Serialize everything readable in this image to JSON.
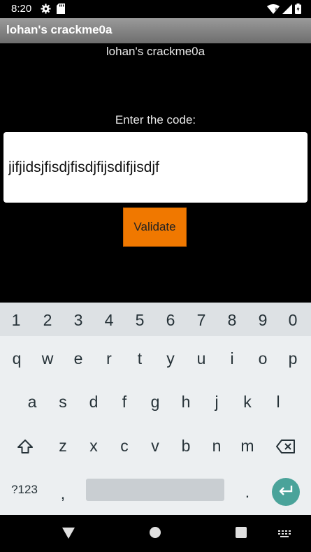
{
  "status_bar": {
    "time": "8:20",
    "icons_left": [
      "gear-icon",
      "sd-card-icon"
    ],
    "icons_right": [
      "wifi-icon",
      "signal-icon",
      "battery-icon"
    ]
  },
  "app_bar": {
    "title": "lohan's crackme0a"
  },
  "main": {
    "subtitle": "lohan's crackme0a",
    "prompt": "Enter the code:",
    "code_input": {
      "value": "jifjidsjfisdjfisdjfijsdifjisdjf",
      "placeholder": ""
    },
    "validate_label": "Validate",
    "validate_color": "#f07800"
  },
  "keyboard": {
    "number_row": [
      "1",
      "2",
      "3",
      "4",
      "5",
      "6",
      "7",
      "8",
      "9",
      "0"
    ],
    "row1": [
      "q",
      "w",
      "e",
      "r",
      "t",
      "y",
      "u",
      "i",
      "o",
      "p"
    ],
    "row2": [
      "a",
      "s",
      "d",
      "f",
      "g",
      "h",
      "j",
      "k",
      "l"
    ],
    "row3": [
      "z",
      "x",
      "c",
      "v",
      "b",
      "n",
      "m"
    ],
    "symbols_label": "?123",
    "comma": ",",
    "period": ".",
    "enter_color": "#4aa39a"
  },
  "nav_bar": {
    "buttons": [
      "back-icon",
      "home-icon",
      "recents-icon",
      "keyboard-switch-icon"
    ]
  }
}
